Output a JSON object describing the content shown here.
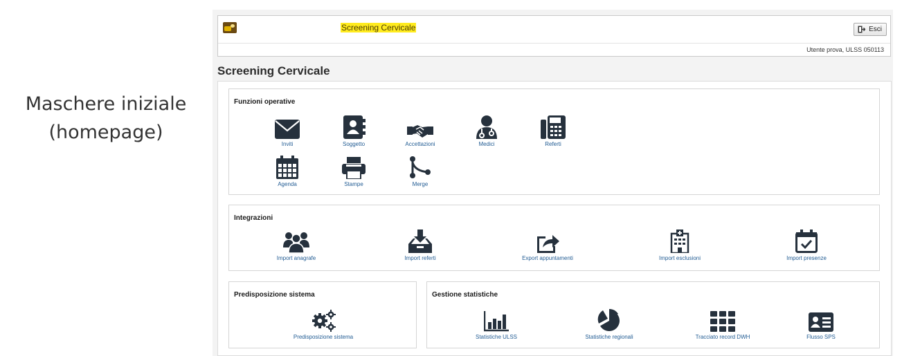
{
  "caption": {
    "line1": "Maschere iniziale",
    "line2": "(homepage)"
  },
  "header": {
    "title": "Screening Cervicale",
    "logout_label": "Esci",
    "user_info": "Utente prova, ULSS 050113"
  },
  "page_title": "Screening Cervicale",
  "sections": {
    "funzioni": {
      "title": "Funzioni operative",
      "items": [
        {
          "label": "Inviti",
          "icon": "envelope-icon"
        },
        {
          "label": "Soggetto",
          "icon": "address-book-icon"
        },
        {
          "label": "Accettazioni",
          "icon": "handshake-icon"
        },
        {
          "label": "Medici",
          "icon": "doctor-icon"
        },
        {
          "label": "Referti",
          "icon": "fax-icon"
        },
        {
          "label": "Agenda",
          "icon": "calendar-icon"
        },
        {
          "label": "Stampe",
          "icon": "printer-icon"
        },
        {
          "label": "Merge",
          "icon": "merge-icon"
        }
      ]
    },
    "integrazioni": {
      "title": "Integrazioni",
      "items": [
        {
          "label": "Import anagrafe",
          "icon": "users-icon"
        },
        {
          "label": "Import referti",
          "icon": "inbox-download-icon"
        },
        {
          "label": "Export appuntamenti",
          "icon": "share-icon"
        },
        {
          "label": "Import esclusioni",
          "icon": "hospital-icon"
        },
        {
          "label": "Import presenze",
          "icon": "calendar-check-icon"
        }
      ]
    },
    "predisposizione": {
      "title": "Predisposizione sistema",
      "items": [
        {
          "label": "Predisposizione sistema",
          "icon": "gears-icon"
        }
      ]
    },
    "statistiche": {
      "title": "Gestione statistiche",
      "items": [
        {
          "label": "Statistiche ULSS",
          "icon": "bar-chart-icon"
        },
        {
          "label": "Statistiche regionali",
          "icon": "pie-chart-icon"
        },
        {
          "label": "Tracciato record DWH",
          "icon": "grid-icon"
        },
        {
          "label": "Flusso SPS",
          "icon": "id-card-icon"
        }
      ]
    }
  },
  "colors": {
    "icon": "#26313d",
    "link": "#1f5a92",
    "highlight": "#ffeb1f"
  }
}
